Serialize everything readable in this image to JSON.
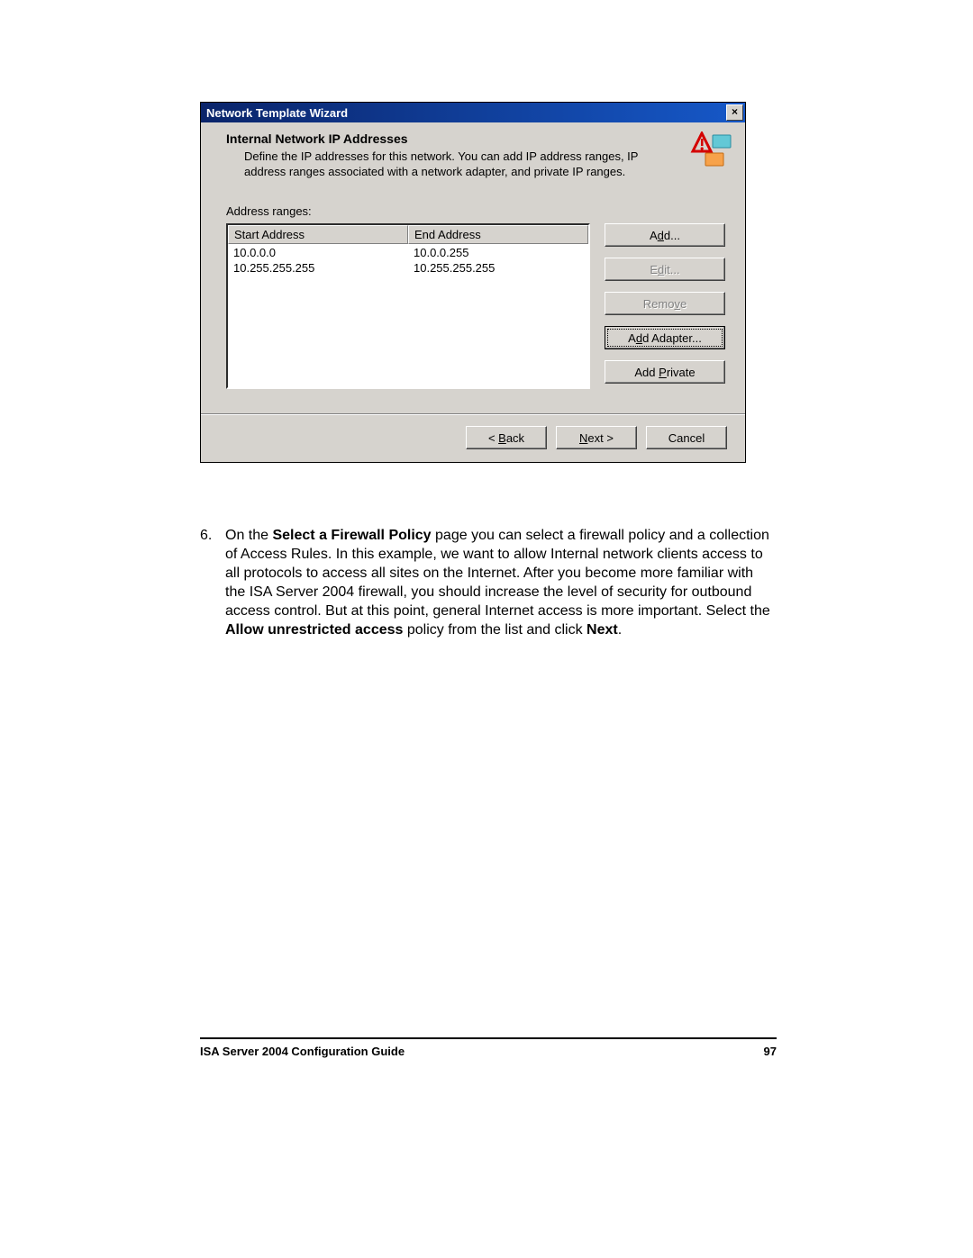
{
  "dialog": {
    "title": "Network Template Wizard",
    "heading": "Internal Network IP Addresses",
    "subtext": "Define the IP addresses for this network. You can add IP address ranges, IP address ranges associated with a network adapter, and private IP ranges.",
    "label": "Address ranges:",
    "columns": {
      "start": "Start Address",
      "end": "End Address"
    },
    "rows": [
      {
        "start": "10.0.0.0",
        "end": "10.0.0.255"
      },
      {
        "start": "10.255.255.255",
        "end": "10.255.255.255"
      }
    ],
    "buttons": {
      "add_pre": "A",
      "add_u": "d",
      "add_post": "d...",
      "edit_pre": "E",
      "edit_u": "d",
      "edit_post": "it...",
      "remove_pre": "Remo",
      "remove_u": "v",
      "remove_post": "e",
      "adapter_pre": "A",
      "adapter_u": "d",
      "adapter_post": "d Adapter...",
      "private_pre": "Add ",
      "private_u": "P",
      "private_post": "rivate"
    },
    "nav": {
      "back_pre": "< ",
      "back_u": "B",
      "back_post": "ack",
      "next_pre": "N",
      "next_u": "e",
      "next_post": "xt >",
      "cancel": "Cancel"
    }
  },
  "doc": {
    "step_num": "6.",
    "text_a": "On the ",
    "text_b": "Select a Firewall Policy",
    "text_c": " page you can select a firewall policy and a collection of Access Rules. In this example, we want to allow Internal network clients access to all protocols to access all sites on the Internet. After you become more familiar with the ISA Server 2004 firewall, you should increase the level of security for outbound access control. But at this point, general Internet access is more important. Select the ",
    "text_d": "Allow unrestricted access",
    "text_e": " policy from the list and click ",
    "text_f": "Next",
    "text_g": "."
  },
  "footer": {
    "title": "ISA Server 2004 Configuration Guide",
    "page": "97"
  }
}
